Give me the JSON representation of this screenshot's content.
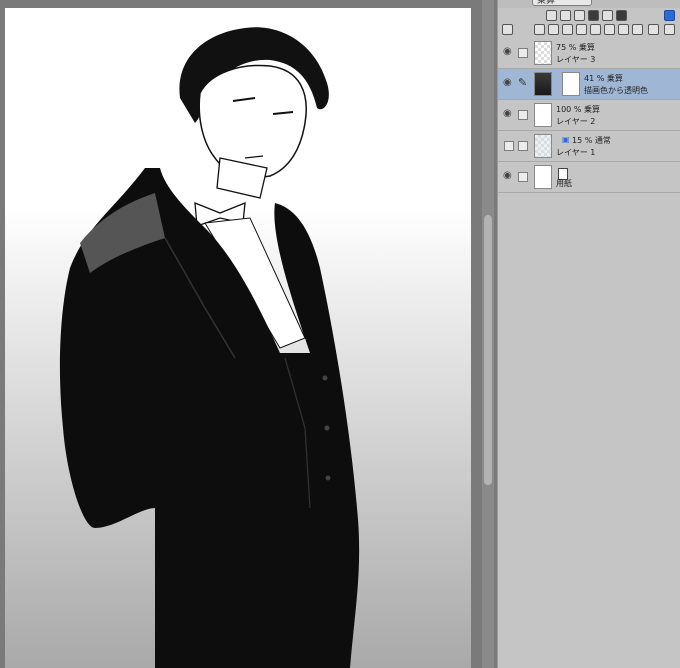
{
  "panel": {
    "blend_mode": "乗算",
    "layers": [
      {
        "name": "75 % 乗算",
        "sub": "レイヤー 3"
      },
      {
        "name": "41 % 乗算",
        "sub": "描画色から透明色"
      },
      {
        "name": "100 % 乗算",
        "sub": "レイヤー 2"
      },
      {
        "name": "15 % 通常",
        "sub": "レイヤー 1"
      },
      {
        "name": "",
        "sub": "用紙"
      }
    ]
  },
  "icons": {
    "visibility": "eye-icon",
    "edit": "pen-icon",
    "paper": "paper-icon"
  }
}
